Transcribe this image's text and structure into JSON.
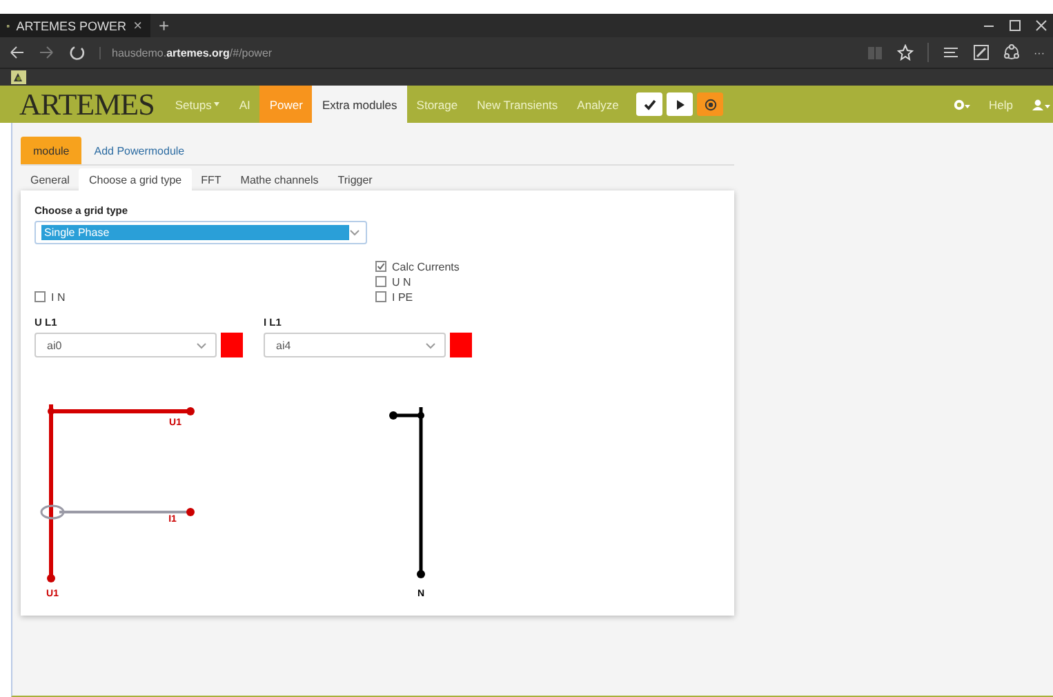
{
  "browser": {
    "tab_title": "ARTEMES POWER",
    "tab_close": "×",
    "new_tab": "+",
    "url": "hausdemo.**artemes.org**/#/power",
    "more": "···"
  },
  "nav": {
    "logo": "ARTEMES",
    "items": [
      {
        "label": "Setups",
        "dropdown": true,
        "selected": false,
        "hovered": false
      },
      {
        "label": "AI",
        "dropdown": false,
        "selected": false,
        "hovered": false
      },
      {
        "label": "Power",
        "dropdown": false,
        "selected": true,
        "hovered": false
      },
      {
        "label": "Extra modules",
        "dropdown": false,
        "selected": false,
        "hovered": true
      },
      {
        "label": "Storage",
        "dropdown": false,
        "selected": false,
        "hovered": false
      },
      {
        "label": "New Transients",
        "dropdown": false,
        "selected": false,
        "hovered": false
      },
      {
        "label": "Analyze",
        "dropdown": false,
        "selected": false,
        "hovered": false
      }
    ],
    "actions": [
      {
        "kind": "check"
      },
      {
        "kind": "play"
      },
      {
        "kind": "record"
      }
    ],
    "help": "Help"
  },
  "module_tabs": [
    {
      "label": "module",
      "selected": true
    },
    {
      "label": "Add Powermodule",
      "selected": false
    }
  ],
  "sub_tabs": [
    {
      "label": "General",
      "selected": false
    },
    {
      "label": "Choose a grid type",
      "selected": true
    },
    {
      "label": "FFT",
      "selected": false
    },
    {
      "label": "Mathe channels",
      "selected": false
    },
    {
      "label": "Trigger",
      "selected": false
    }
  ],
  "grid_type": {
    "label": "Choose a grid type",
    "value": "Single Phase"
  },
  "checkboxes_right": [
    {
      "label": "Calc Currents",
      "checked": true
    },
    {
      "label": "U N",
      "checked": false
    },
    {
      "label": "I PE",
      "checked": false
    }
  ],
  "checkboxes_left": [
    {
      "label": "I N",
      "checked": false
    }
  ],
  "channels": [
    {
      "label": "U L1",
      "value": "ai0",
      "color": "#ff0000"
    },
    {
      "label": "I L1",
      "value": "ai4",
      "color": "#ff0000"
    }
  ],
  "diagram": {
    "labels": [
      "U1",
      "I1",
      "U1",
      "N"
    ]
  }
}
